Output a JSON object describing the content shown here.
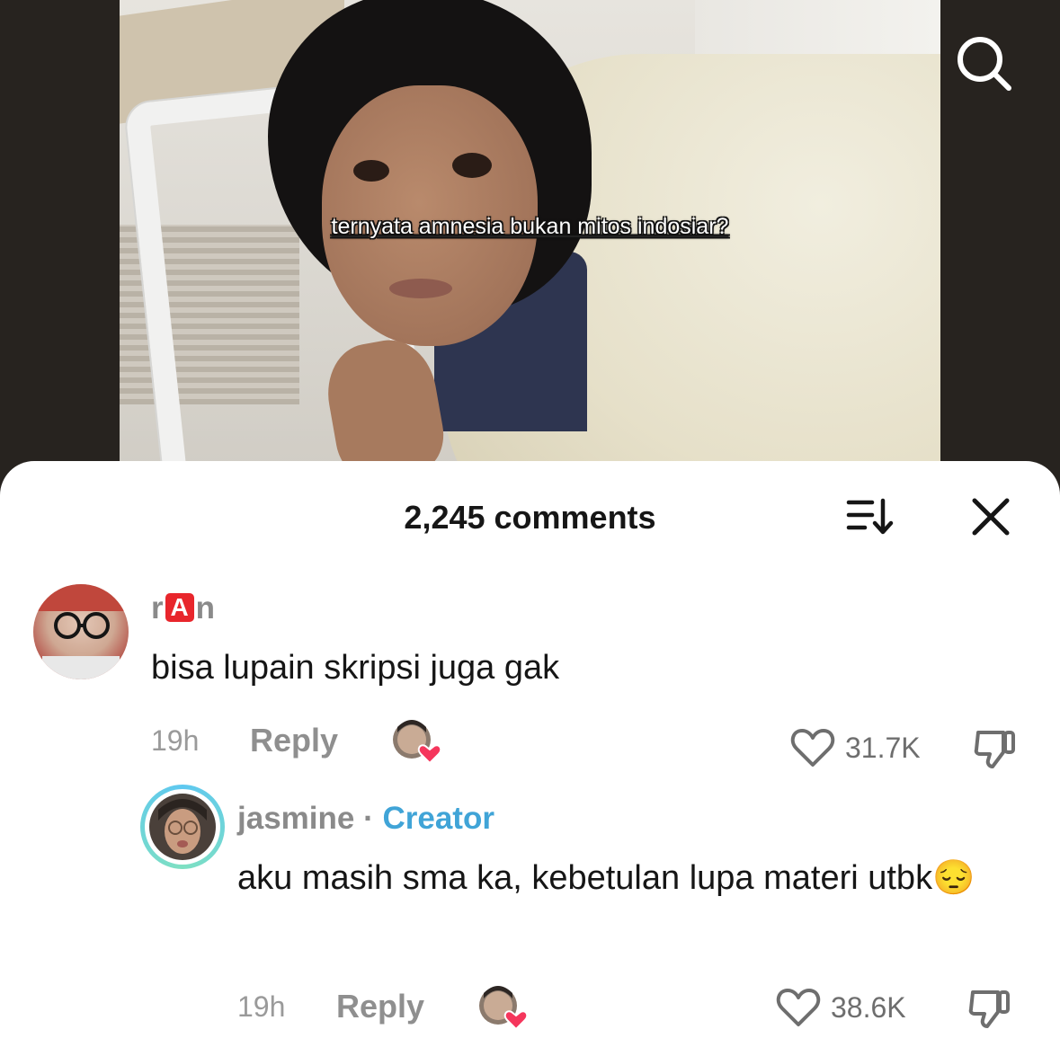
{
  "video": {
    "caption": "ternyata amnesia bukan mitos indosiar?"
  },
  "comments_sheet": {
    "title": "2,245 comments",
    "comments": [
      {
        "username_parts": [
          "r",
          "A",
          "n"
        ],
        "text": "bisa lupain skripsi juga gak",
        "time": "19h",
        "reply_label": "Reply",
        "likes": "31.7K",
        "liked_by_creator": true
      },
      {
        "username": "jasmine",
        "separator": "·",
        "badge": "Creator",
        "text": "aku masih sma ka, kebetulan lupa materi utbk",
        "emoji": "😔",
        "time": "19h",
        "reply_label": "Reply",
        "likes": "38.6K",
        "liked_by_creator": true
      }
    ]
  },
  "icons": {
    "search": "search-icon",
    "sort": "sort-icon",
    "close": "close-icon",
    "like": "heart-icon",
    "dislike": "thumbs-down-icon"
  },
  "colors": {
    "creator_badge": "#40a4d7",
    "heart_red": "#f5365c",
    "creator_ring_start": "#5ec8f0",
    "creator_ring_end": "#7ee0c2"
  }
}
